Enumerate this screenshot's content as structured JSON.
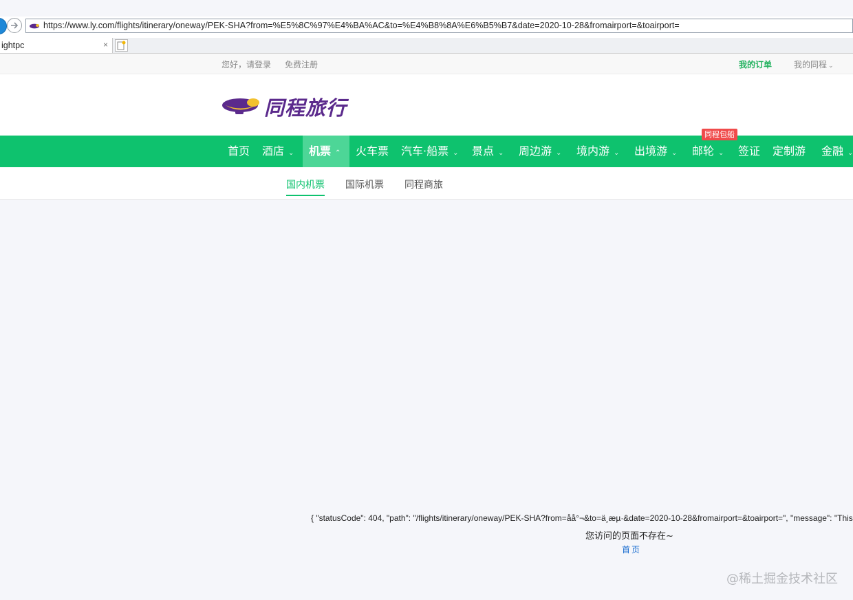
{
  "browser": {
    "url": "https://www.ly.com/flights/itinerary/oneway/PEK-SHA?from=%E5%8C%97%E4%BA%AC&to=%E4%B8%8A%E6%B5%B7&date=2020-10-28&fromairport=&toairport=",
    "tab_title": "ightpc",
    "tab_close": "×",
    "back_icon": "back-arrow-icon",
    "forward_icon": "forward-arrow-icon"
  },
  "topbar": {
    "login": "您好，请登录",
    "register": "免费注册",
    "orders": "我的订单",
    "trip": "我的同程",
    "trip_caret": "⌄"
  },
  "header": {
    "logo_text": "同程旅行"
  },
  "nav": {
    "badge": "同程包船",
    "items": [
      {
        "label": "首页"
      },
      {
        "label": "酒店",
        "caret": "⌄"
      },
      {
        "label": "机票",
        "caret": "⌃"
      },
      {
        "label": "火车票"
      },
      {
        "label": "汽车·船票",
        "caret": "⌄"
      },
      {
        "label": "景点",
        "caret": "⌄"
      },
      {
        "label": "周边游",
        "caret": "⌄"
      },
      {
        "label": "境内游",
        "caret": "⌄"
      },
      {
        "label": "出境游",
        "caret": "⌄"
      },
      {
        "label": "邮轮",
        "caret": "⌄"
      },
      {
        "label": "签证"
      },
      {
        "label": "定制游"
      },
      {
        "label": "金融",
        "caret": "⌄"
      }
    ]
  },
  "subnav": {
    "items": [
      {
        "label": "国内机票"
      },
      {
        "label": "国际机票"
      },
      {
        "label": "同程商旅"
      }
    ]
  },
  "error": {
    "json_text": "{ \"statusCode\": 404, \"path\": \"/flights/itinerary/oneway/PEK-SHA?from=åå°¬&to=ä¸æµ·&date=2020-10-28&fromairport=&toairport=\", \"message\": \"This",
    "message": "您访问的页面不存在~",
    "home_link": "首页"
  },
  "watermark": "@稀土掘金技术社区",
  "colors": {
    "nav_green": "#0ec26e",
    "nav_active": "#4dd697",
    "orders_green": "#23b25f",
    "badge_red": "#f04b4b",
    "logo_purple": "#5b2a8c",
    "link_blue": "#1a6dd0"
  }
}
